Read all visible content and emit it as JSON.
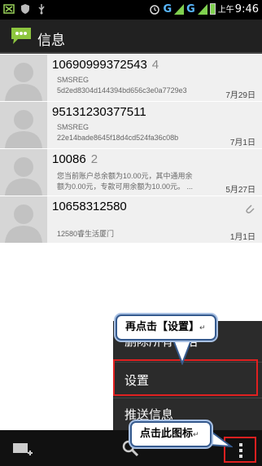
{
  "status_bar": {
    "network_letter_1": "G",
    "network_letter_2": "G",
    "time_prefix": "上午",
    "time": "9:46",
    "icons": [
      "notification-icon",
      "shield-icon",
      "usb-icon",
      "alarm-icon",
      "signal-icon",
      "signal-icon",
      "battery-icon"
    ]
  },
  "header": {
    "title": "信息",
    "icon": "chat-bubble-icon"
  },
  "conversations": [
    {
      "name": "10690999372543",
      "count": "4",
      "line1": "SMSREG",
      "line2": "5d2ed8304d144394bd656c3e0a7729e3",
      "date": "7月29日"
    },
    {
      "name": "95131230377511",
      "count": "",
      "line1": "SMSREG",
      "line2": "22e14bade8645f18d4cd524fa36c08b",
      "date": "7月1日"
    },
    {
      "name": "10086",
      "count": "2",
      "line1": "您当前账户总余额为10.00元，其中通用余",
      "line2": "额为0.00元，专款可用余额为10.00元。 ...",
      "date": "5月27日"
    },
    {
      "name": "10658312580",
      "count": "",
      "line1": "",
      "line2": "12580睿生活厦门",
      "date": "1月1日",
      "attachment": true
    }
  ],
  "menu": {
    "items": [
      "删除所有会话",
      "设置",
      "推送信息"
    ]
  },
  "callouts": {
    "step1": "再点击【设置】",
    "step2": "点击此图标",
    "return_mark": "↵"
  },
  "bottom_bar": {
    "icons": [
      "compose-icon",
      "search-icon",
      "overflow-menu-icon"
    ]
  },
  "colors": {
    "highlight_border": "#e02020",
    "callout_border": "#365b8f",
    "network_blue": "#59b8ff",
    "battery_green": "#7fd04f"
  }
}
